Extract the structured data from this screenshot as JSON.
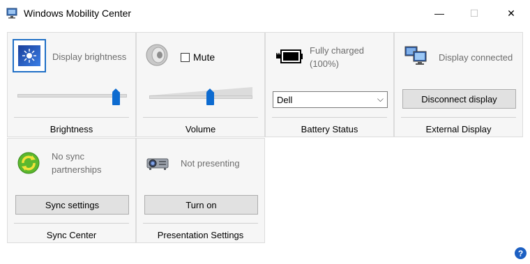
{
  "window": {
    "title": "Windows Mobility Center",
    "minimize_glyph": "—",
    "maximize_glyph": "☐",
    "close_glyph": "✕"
  },
  "tiles": {
    "brightness": {
      "status": "Display brightness",
      "title": "Brightness",
      "level_fraction": 0.93,
      "icon": "display-brightness-icon"
    },
    "volume": {
      "mute_label": "Mute",
      "mute_checked": false,
      "title": "Volume",
      "level_fraction": 0.6,
      "icon": "speaker-icon"
    },
    "battery": {
      "status_line1": "Fully charged",
      "status_line2": "(100%)",
      "plan_selected": "Dell",
      "title": "Battery Status",
      "icon": "battery-plug-icon"
    },
    "external_display": {
      "status": "Display connected",
      "button_label": "Disconnect display",
      "title": "External Display",
      "icon": "monitors-icon"
    },
    "sync": {
      "status_line1": "No sync",
      "status_line2": "partnerships",
      "button_label": "Sync settings",
      "title": "Sync Center",
      "icon": "sync-icon"
    },
    "presentation": {
      "status": "Not presenting",
      "button_label": "Turn on",
      "title": "Presentation Settings",
      "icon": "projector-icon"
    }
  },
  "help": {
    "glyph": "?"
  },
  "colors": {
    "tile_bg": "#f6f6f6",
    "accent": "#0d6bd0",
    "status_text": "#6d6d6d"
  }
}
